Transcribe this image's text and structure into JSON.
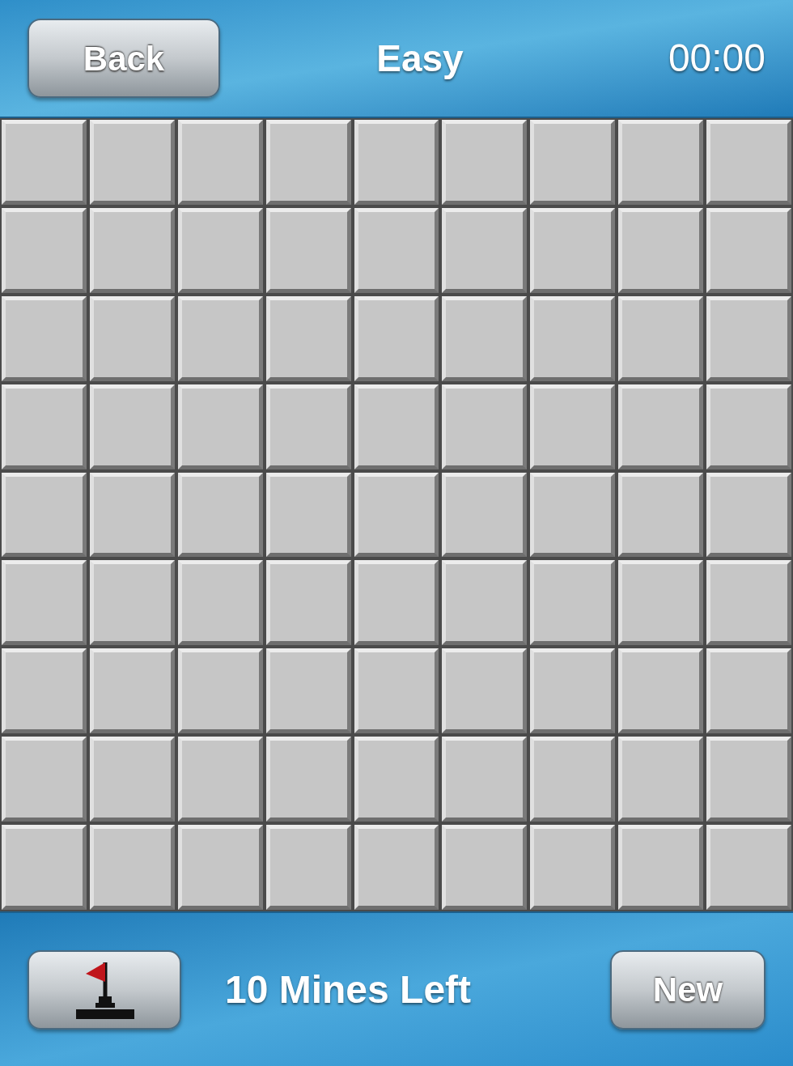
{
  "header": {
    "back_button": "Back",
    "title": "Easy",
    "timer": "00:00"
  },
  "board": {
    "rows": [
      [
        {
          "revealed": false
        },
        {
          "revealed": false
        },
        {
          "revealed": false
        },
        {
          "revealed": false
        },
        {
          "revealed": false
        },
        {
          "revealed": false
        },
        {
          "revealed": false
        },
        {
          "revealed": false
        },
        {
          "revealed": false
        }
      ],
      [
        {
          "revealed": false
        },
        {
          "revealed": false
        },
        {
          "revealed": false
        },
        {
          "revealed": false
        },
        {
          "revealed": false
        },
        {
          "revealed": false
        },
        {
          "revealed": false
        },
        {
          "revealed": false
        },
        {
          "revealed": false
        }
      ],
      [
        {
          "revealed": false
        },
        {
          "revealed": false
        },
        {
          "revealed": false
        },
        {
          "revealed": false
        },
        {
          "revealed": false
        },
        {
          "revealed": false
        },
        {
          "revealed": false
        },
        {
          "revealed": false
        },
        {
          "revealed": false
        }
      ],
      [
        {
          "revealed": false
        },
        {
          "revealed": false
        },
        {
          "revealed": false
        },
        {
          "revealed": false
        },
        {
          "revealed": false
        },
        {
          "revealed": false
        },
        {
          "revealed": false
        },
        {
          "revealed": false
        },
        {
          "revealed": false
        }
      ],
      [
        {
          "revealed": false
        },
        {
          "revealed": false
        },
        {
          "revealed": false
        },
        {
          "revealed": false
        },
        {
          "revealed": false
        },
        {
          "revealed": false
        },
        {
          "revealed": false
        },
        {
          "revealed": false
        },
        {
          "revealed": false
        }
      ],
      [
        {
          "revealed": false
        },
        {
          "revealed": false
        },
        {
          "revealed": false
        },
        {
          "revealed": false
        },
        {
          "revealed": false
        },
        {
          "revealed": false
        },
        {
          "revealed": false
        },
        {
          "revealed": false
        },
        {
          "revealed": false
        }
      ],
      [
        {
          "revealed": false
        },
        {
          "revealed": false
        },
        {
          "revealed": false
        },
        {
          "revealed": false
        },
        {
          "revealed": false
        },
        {
          "revealed": false
        },
        {
          "revealed": false
        },
        {
          "revealed": false
        },
        {
          "revealed": false
        }
      ],
      [
        {
          "revealed": false
        },
        {
          "revealed": false
        },
        {
          "revealed": false
        },
        {
          "revealed": false
        },
        {
          "revealed": false
        },
        {
          "revealed": false
        },
        {
          "revealed": false
        },
        {
          "revealed": false
        },
        {
          "revealed": false
        }
      ],
      [
        {
          "revealed": false
        },
        {
          "revealed": false
        },
        {
          "revealed": false
        },
        {
          "revealed": false
        },
        {
          "revealed": false
        },
        {
          "revealed": false
        },
        {
          "revealed": false
        },
        {
          "revealed": false
        },
        {
          "revealed": false
        }
      ]
    ]
  },
  "footer": {
    "mines_left": "10 Mines Left",
    "new_button": "New"
  }
}
